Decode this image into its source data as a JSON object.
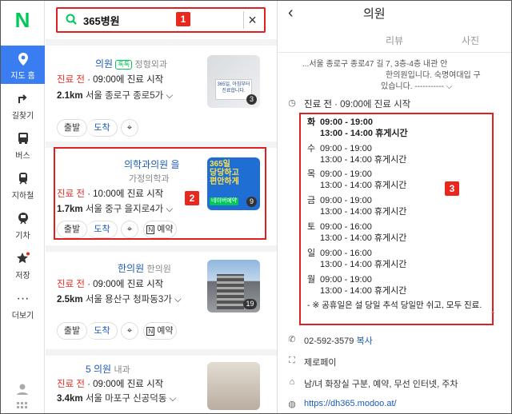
{
  "rail": {
    "logo": "N",
    "items": [
      {
        "label": "지도 홈",
        "icon": "map-pin-icon"
      },
      {
        "label": "길찾기",
        "icon": "directions-icon"
      },
      {
        "label": "버스",
        "icon": "bus-icon"
      },
      {
        "label": "지하철",
        "icon": "subway-icon"
      },
      {
        "label": "기차",
        "icon": "train-icon"
      },
      {
        "label": "저장",
        "icon": "star-icon"
      },
      {
        "label": "더보기",
        "icon": "more-icon"
      }
    ]
  },
  "search": {
    "query": "365병원",
    "icon": "search-icon",
    "clear_icon": "close-icon"
  },
  "markers": {
    "m1": "1",
    "m2": "2",
    "m3": "3"
  },
  "results": [
    {
      "name": "의원",
      "badge_icon": "chat-icon",
      "badge_text": "톡톡",
      "category": "정형외과",
      "status_red": "진료 전",
      "status_rest": " · 09:00에 진료 시작",
      "distance": "2.1km",
      "address": "서울 종로구 종로5가",
      "photo_count": "3",
      "thumb_text": "365일, 아침부터\n진료합니다.",
      "buttons": [
        "출발",
        "도착"
      ]
    },
    {
      "name": "의학과의원 을",
      "category": "가정의학과",
      "status_red": "진료 전",
      "status_rest": " · 10:00에 진료 시작",
      "distance": "1.7km",
      "address": "서울 중구 을지로4가",
      "photo_count": "9",
      "thumb_text": "365일\n당당하고\n편안하게",
      "thumb_sub": "네이버예약",
      "buttons": [
        "출발",
        "도착"
      ],
      "reserve": "예약"
    },
    {
      "name": "한의원",
      "category": "한의원",
      "status_red": "진료 전",
      "status_rest": " · 09:00에 진료 시작",
      "distance": "2.5km",
      "address": "서울 용산구 청파동3가",
      "photo_count": "19",
      "buttons": [
        "출발",
        "도착"
      ],
      "reserve": "예약"
    },
    {
      "name": "5 의원",
      "category": "내과",
      "status_red": "진료 전",
      "status_rest": " · 09:00에 진료 시작",
      "distance": "3.4km",
      "address": "서울 마포구 신공덕동"
    }
  ],
  "detail": {
    "title": "의원",
    "tabs": [
      "리뷰",
      "사진"
    ],
    "desc_line1": "...서울 종로구 종로47 길 7, 3층-4층 내관 안",
    "desc_line2": "한의원입니다. 숙명여대입 구",
    "desc_line3": "있습니다. -----------",
    "status_red": "진료 전",
    "status_rest": " · 09:00에 진료 시작",
    "hours": [
      {
        "day": "화",
        "time": "09:00 - 19:00",
        "break": "13:00 - 14:00 휴게시간",
        "bold": true
      },
      {
        "day": "수",
        "time": "09:00 - 19:00",
        "break": "13:00 - 14:00 휴게시간"
      },
      {
        "day": "목",
        "time": "09:00 - 19:00",
        "break": "13:00 - 14:00 휴게시간"
      },
      {
        "day": "금",
        "time": "09:00 - 19:00",
        "break": "13:00 - 14:00 휴게시간"
      },
      {
        "day": "토",
        "time": "09:00 - 16:00",
        "break": "13:00 - 14:00 휴게시간"
      },
      {
        "day": "일",
        "time": "09:00 - 16:00",
        "break": "13:00 - 14:00 휴게시간"
      },
      {
        "day": "월",
        "time": "09:00 - 19:00",
        "break": "13:00 - 14:00 휴게시간"
      }
    ],
    "holiday_note": "- ※ 공휴일은 설 당일 추석 당일만 쉬고, 모두 진료.",
    "phone": "02-592-3579",
    "copy": "복사",
    "payment": "제로페이",
    "amenities": "남/녀 화장실 구분, 예약, 무선 인터넷, 주차",
    "website": "https://dh365.modoo.at/"
  }
}
